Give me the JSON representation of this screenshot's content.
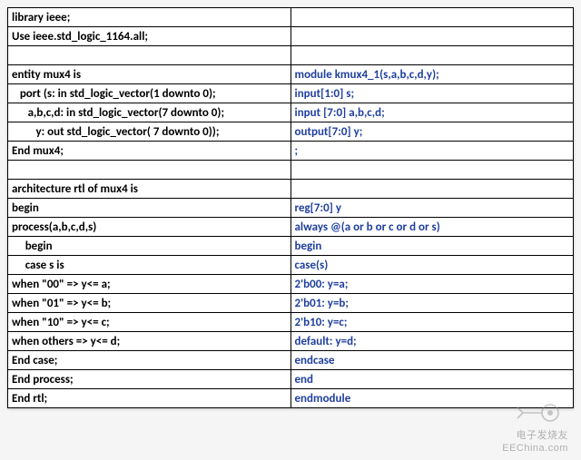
{
  "rows": [
    {
      "left": "library ieee;",
      "right": ""
    },
    {
      "left": "Use ieee.std_logic_1164.all;",
      "right": ""
    },
    {
      "left": "",
      "right": ""
    },
    {
      "left": "entity mux4 is",
      "right": "module kmux4_1(s,a,b,c,d,y);"
    },
    {
      "left": "   port (s: in std_logic_vector(1 downto 0);",
      "right": "input[1:0] s;"
    },
    {
      "left": "      a,b,c,d: in std_logic_vector(7 downto 0);",
      "right": "input [7:0] a,b,c,d;"
    },
    {
      "left": "         y: out std_logic_vector( 7 downto 0));",
      "right": "output[7:0] y;"
    },
    {
      "left": "End mux4;",
      "right": ";"
    },
    {
      "left": "",
      "right": ""
    },
    {
      "left": "architecture rtl of mux4 is",
      "right": ""
    },
    {
      "left": "begin",
      "right": "reg[7:0] y"
    },
    {
      "left": "process(a,b,c,d,s)",
      "right": "always @(a or b or c or d or s)"
    },
    {
      "left": "     begin",
      "right": "begin"
    },
    {
      "left": "     case s is",
      "right": "case(s)"
    },
    {
      "left": "when \"00\" => y<= a;",
      "right": "2'b00: y=a;"
    },
    {
      "left": "when \"01\" => y<= b;",
      "right": "2'b01: y=b;"
    },
    {
      "left": "when \"10\" => y<= c;",
      "right": "2'b10: y=c;"
    },
    {
      "left": "when others => y<= d;",
      "right": "default: y=d;"
    },
    {
      "left": "End case;",
      "right": "endcase"
    },
    {
      "left": "End process;",
      "right": "end"
    },
    {
      "left": "End rtl;",
      "right": "endmodule"
    }
  ],
  "watermark": {
    "line1": "电子发烧友",
    "line2": "EEChina.com"
  }
}
